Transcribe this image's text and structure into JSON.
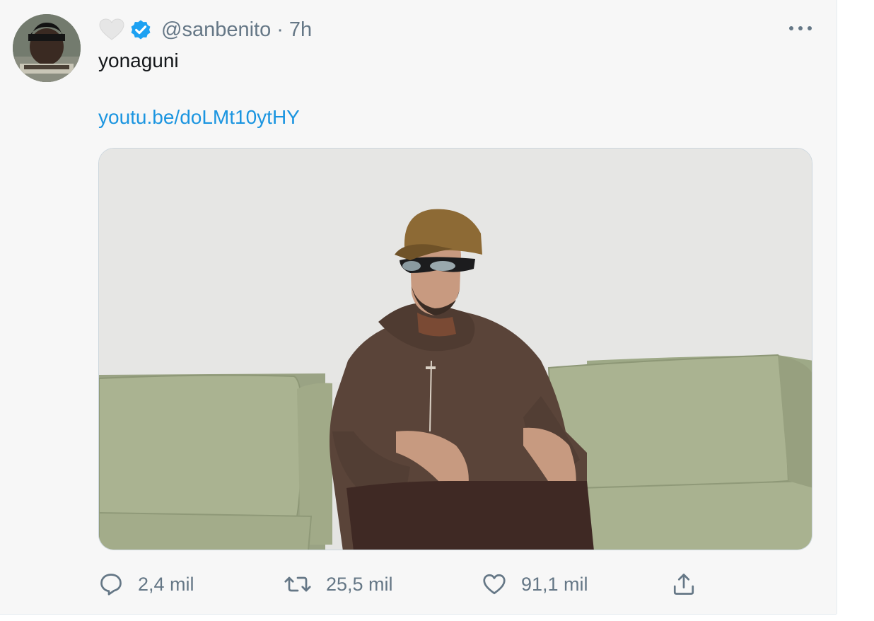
{
  "tweet": {
    "handle": "@sanbenito",
    "separator": "·",
    "time": "7h",
    "text": "yonaguni",
    "link": "youtu.be/doLMt10ytHY",
    "badges": [
      "heart-icon",
      "verified-badge-icon"
    ],
    "more_icon": "more-icon"
  },
  "actions": {
    "reply_count": "2,4 mil",
    "retweet_count": "25,5 mil",
    "like_count": "91,1 mil",
    "share_icon": "share-icon"
  },
  "colors": {
    "link": "#1b95e0",
    "secondary_text": "#657786",
    "primary_text": "#14171a",
    "verified": "#1da1f2",
    "background": "#f7f7f7"
  }
}
